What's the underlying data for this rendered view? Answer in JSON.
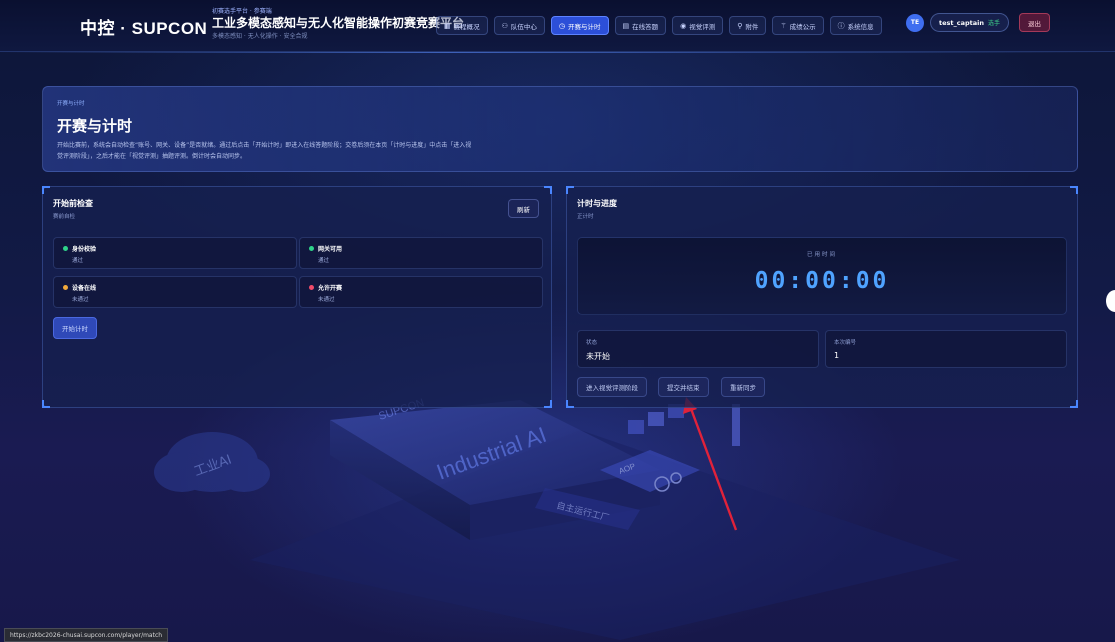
{
  "header": {
    "brand": "中控 · SUPCON",
    "stage_tag": "初赛选手平台 · 参赛端",
    "platform_title": "工业多模态感知与无人化智能操作初赛竞赛平台",
    "platform_subtitle": "多模态感知 · 无人化操作 · 安全合规",
    "nav": [
      {
        "icon": "grid-icon",
        "glyph": "▦",
        "label": "赛程概况",
        "active": false
      },
      {
        "icon": "team-icon",
        "glyph": "⚇",
        "label": "队伍中心",
        "active": false
      },
      {
        "icon": "clock-icon",
        "glyph": "◷",
        "label": "开赛与计时",
        "active": true
      },
      {
        "icon": "document-icon",
        "glyph": "▤",
        "label": "在线答题",
        "active": false
      },
      {
        "icon": "eye-icon",
        "glyph": "◉",
        "label": "视觉评测",
        "active": false
      },
      {
        "icon": "paperclip-icon",
        "glyph": "⚲",
        "label": "附件",
        "active": false
      },
      {
        "icon": "scores-icon",
        "glyph": "⚚",
        "label": "成绩公示",
        "active": false
      },
      {
        "icon": "info-icon",
        "glyph": "ⓘ",
        "label": "系统信息",
        "active": false
      }
    ],
    "user": {
      "initials": "TE",
      "name": "test_captain",
      "role": "选手",
      "logout_label": "退出"
    }
  },
  "hero": {
    "tag": "开赛与计时",
    "title": "开赛与计时",
    "description": "开始比赛前，系统会自动检查“账号、网关、设备”是否就绪。通过后点击「开始计时」即进入在线答题阶段；交卷后须在本页「计时与进度」中点击「进入视觉评测阶段」，之后才能在「视觉评测」抽题评测。倒计时会自动同步。"
  },
  "precheck": {
    "title": "开始前检查",
    "subtitle": "赛前自检",
    "refresh_label": "刷新",
    "items": [
      {
        "name": "身份校验",
        "status": "通过",
        "color": "#2fd38a"
      },
      {
        "name": "网关可用",
        "status": "通过",
        "color": "#2fd38a"
      },
      {
        "name": "设备在线",
        "status": "未通过",
        "color": "#f2a93b"
      },
      {
        "name": "允许开赛",
        "status": "未通过",
        "color": "#f04b6a"
      }
    ],
    "start_label": "开始计时"
  },
  "timer": {
    "title": "计时与进度",
    "subtitle": "正计时",
    "elapsed_label": "已用时间",
    "elapsed_value": "00:00:00",
    "state_label": "状态",
    "state_value": "未开始",
    "round_label": "本次编号",
    "round_value": "1",
    "actions": [
      "进入视觉评测阶段",
      "提交并结束",
      "重新同步"
    ]
  },
  "scenery": {
    "chip_label_1": "Industrial AI",
    "chip_label_2": "SUPCON",
    "cloud_label": "工业AI",
    "module_label": "AOP",
    "factory_label": "自主运行工厂"
  },
  "status_bar": {
    "url": "https://zkbc2026-chusai.supcon.com/player/match"
  },
  "colors": {
    "accent": "#2c4fd8",
    "timer": "#4fa3ff",
    "annotation_arrow": "#e0223a"
  }
}
